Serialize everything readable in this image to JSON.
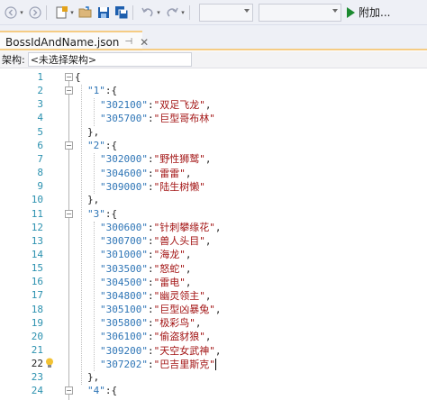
{
  "toolbar": {
    "run_label": "附加..."
  },
  "tab": {
    "title": "BossIdAndName.json",
    "pin": "⊣",
    "close": "✕"
  },
  "schema": {
    "label": "架构:",
    "value": "<未选择架构>"
  },
  "editor": {
    "lines": [
      {
        "n": "1",
        "text": "{"
      },
      {
        "n": "2",
        "key": "\"1\"",
        "text": ":{"
      },
      {
        "n": "3",
        "key": "\"302100\"",
        "sep": ":",
        "val": "\"双足飞龙\"",
        "tail": ","
      },
      {
        "n": "4",
        "key": "\"305700\"",
        "sep": ":",
        "val": "\"巨型哥布林\"",
        "tail": ""
      },
      {
        "n": "5",
        "text": "},"
      },
      {
        "n": "6",
        "key": "\"2\"",
        "text": ":{"
      },
      {
        "n": "7",
        "key": "\"302000\"",
        "sep": ":",
        "val": "\"野性狮鹫\"",
        "tail": ","
      },
      {
        "n": "8",
        "key": "\"304600\"",
        "sep": ":",
        "val": "\"雷雷\"",
        "tail": ","
      },
      {
        "n": "9",
        "key": "\"309000\"",
        "sep": ":",
        "val": "\"陆生树懒\"",
        "tail": ""
      },
      {
        "n": "10",
        "text": "},"
      },
      {
        "n": "11",
        "key": "\"3\"",
        "text": ":{"
      },
      {
        "n": "12",
        "key": "\"300600\"",
        "sep": ":",
        "val": "\"针刺攀缘花\"",
        "tail": ","
      },
      {
        "n": "13",
        "key": "\"300700\"",
        "sep": ":",
        "val": "\"兽人头目\"",
        "tail": ","
      },
      {
        "n": "14",
        "key": "\"301000\"",
        "sep": ":",
        "val": "\"海龙\"",
        "tail": ","
      },
      {
        "n": "15",
        "key": "\"303500\"",
        "sep": ":",
        "val": "\"怒蛇\"",
        "tail": ","
      },
      {
        "n": "16",
        "key": "\"304500\"",
        "sep": ":",
        "val": "\"雷电\"",
        "tail": ","
      },
      {
        "n": "17",
        "key": "\"304800\"",
        "sep": ":",
        "val": "\"幽灵领主\"",
        "tail": ","
      },
      {
        "n": "18",
        "key": "\"305100\"",
        "sep": ":",
        "val": "\"巨型凶暴兔\"",
        "tail": ","
      },
      {
        "n": "19",
        "key": "\"305800\"",
        "sep": ":",
        "val": "\"极彩鸟\"",
        "tail": ","
      },
      {
        "n": "20",
        "key": "\"306100\"",
        "sep": ":",
        "val": "\"偷盗豺狼\"",
        "tail": ","
      },
      {
        "n": "21",
        "key": "\"309200\"",
        "sep": ":",
        "val": "\"天空女武神\"",
        "tail": ","
      },
      {
        "n": "22",
        "key": "\"307202\"",
        "sep": ":",
        "val": "\"巴吉里斯克\"",
        "tail": ""
      },
      {
        "n": "23",
        "text": "},"
      },
      {
        "n": "24",
        "key": "\"4\"",
        "text": ":{"
      }
    ]
  }
}
